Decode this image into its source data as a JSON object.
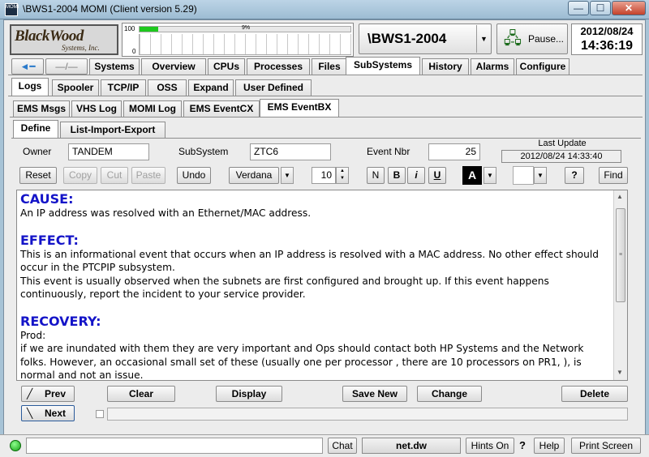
{
  "window": {
    "app_icon_text": "MOMI",
    "title": "\\BWS1-2004 MOMI (Client version 5.29)",
    "minimize": "—",
    "maximize": "☐",
    "close": "✕"
  },
  "header": {
    "logo_line1": "BlackWood",
    "logo_line2": "Systems, Inc.",
    "gauge_top_label": "100",
    "gauge_bottom_label": "0",
    "cpu_percent_label": "9%",
    "cpu_percent": 9,
    "system_name": "\\BWS1-2004",
    "pause_label": "Pause...",
    "date": "2012/08/24",
    "time": "14:36:19"
  },
  "main_tabs": [
    "Systems",
    "Overview",
    "CPUs",
    "Processes",
    "Files",
    "SubSystems",
    "History",
    "Alarms",
    "Configure"
  ],
  "main_tab_active": "SubSystems",
  "sub_tabs": [
    "Logs",
    "Spooler",
    "TCP/IP",
    "OSS",
    "Expand",
    "User Defined"
  ],
  "log_tabs": [
    "EMS Msgs",
    "VHS Log",
    "MOMI Log",
    "EMS EventCX",
    "EMS EventBX"
  ],
  "define_tabs": [
    "Define",
    "List-Import-Export"
  ],
  "form": {
    "owner_label": "Owner",
    "owner_value": "TANDEM",
    "subsystem_label": "SubSystem",
    "subsystem_value": "ZTC6",
    "event_label": "Event  Nbr",
    "event_value": "25",
    "last_update_label": "Last Update",
    "last_update_value": "2012/08/24 14:33:40"
  },
  "toolbar": {
    "reset": "Reset",
    "copy": "Copy",
    "cut": "Cut",
    "paste": "Paste",
    "undo": "Undo",
    "font": "Verdana",
    "size": "10",
    "normal": "N",
    "bold": "B",
    "italic": "i",
    "underline": "U",
    "color": "A",
    "help": "?",
    "find": "Find"
  },
  "content": {
    "cause_heading": "CAUSE:",
    "cause_text": "An IP address was resolved with an Ethernet/MAC address.",
    "effect_heading": "EFFECT:",
    "effect_text1": "This is an informational event that occurs when an IP address is resolved with a MAC address. No other effect should occur in the PTCPIP subsystem.",
    "effect_text2": "This event is usually observed when the subnets are first configured and brought up. If this event happens continuously, report the incident to your service provider.",
    "recovery_heading": "RECOVERY:",
    "recovery_text1": "Prod:",
    "recovery_text2": "if we are  inundated with them they are very important and Ops should contact both HP Systems and the Network folks.  However, an occasional small set of these (usually one per processor , there are 10 processors on PR1, ), is normal and not an issue."
  },
  "actions": {
    "prev": "Prev",
    "next": "Next",
    "clear": "Clear",
    "display": "Display",
    "save_new": "Save New",
    "change": "Change",
    "delete": "Delete"
  },
  "status": {
    "chat": "Chat",
    "server": "net.dw",
    "hints": "Hints On",
    "question": "?",
    "help": "Help",
    "print": "Print Screen"
  }
}
